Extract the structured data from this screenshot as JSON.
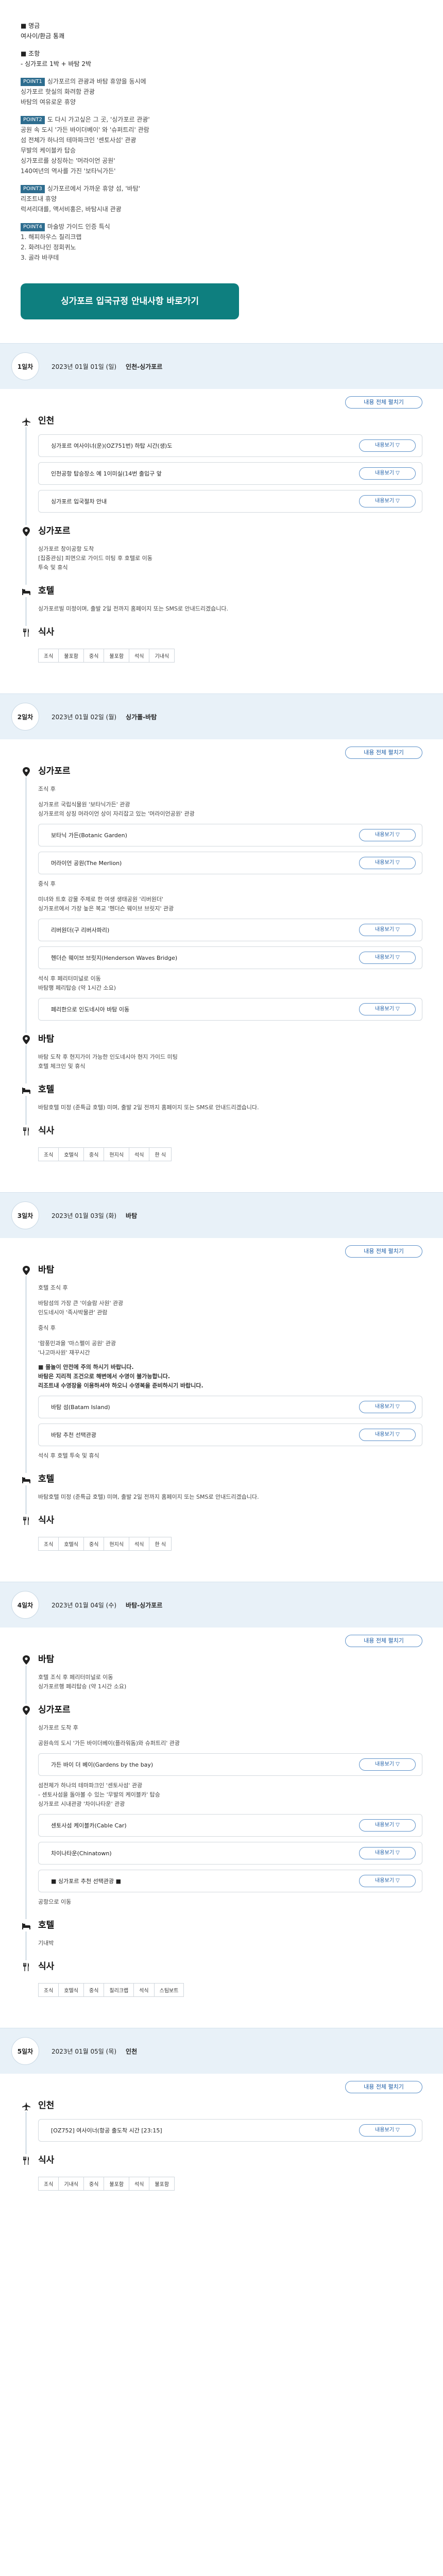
{
  "intro": {
    "heading_lines": [
      "■ 명금",
      "여사이/환금 통쾌"
    ],
    "block1": [
      "■ 조항",
      "- 싱가포르 1박 + 바탐 2박"
    ],
    "points": [
      {
        "badge": "POINT1",
        "lines": [
          "싱가포르의 관광과 바탐 휴양을 동시에",
          "싱가포르 핫실의 화려함 관광",
          "바탐의 여유로운 휴양"
        ]
      },
      {
        "badge": "POINT2",
        "lines": [
          "도 다시 가고싶은 그 곳, '싱가포르 관광'",
          "공원 속 도시 '가든 바이더베이' 와 '슈퍼트리' 관람",
          "섬 전체가 하나의 테마파크인 '센토사섬' 관광",
          "무발의 케이블카 탑승",
          "싱가포르를 상징하는 '머라이언 공원'",
          "140여년의 역사를 가진 '보타닉가든'"
        ]
      },
      {
        "badge": "POINT3",
        "lines": [
          "싱가포르에서 가까운 휴양 섬, '바탐'",
          "리조트내 휴양",
          "럭셔리대를, 액서비홍은, 바탐시내 관광"
        ]
      },
      {
        "badge": "POINT4",
        "lines": [
          "마술방 가이드 인증 특식",
          "1. 해피하우스 칠리크랩",
          "2. 화려나인 정회퀴노",
          "3. 골라 바쿠테"
        ]
      }
    ],
    "cta": "싱가포르 입국규정 안내사항 바로가기"
  },
  "ui": {
    "expand_all": "내용 전체 펼치기",
    "detail": "내용보기 ▽"
  },
  "meal_labels": [
    "조식",
    "중식",
    "석식"
  ],
  "days": [
    {
      "badge": "1일차",
      "date": "2023년 01월 01일 (일)",
      "route": "인천-싱가포르",
      "sections": [
        {
          "title": "인천",
          "lines": [],
          "items": [
            {
              "name": "싱가포르 여사이너(운)(OZ751번) 하탑 시간(생)도"
            },
            {
              "name": "인천공항 탑승장소 예 1이미실(14번 출입구 앞"
            },
            {
              "name": "싱가포르 입국절차 안내"
            }
          ]
        },
        {
          "title": "싱가포르",
          "lines": [
            "싱가포르 창이공항 도착",
            "[집중관심] 피면으로 가이드 미팅 후 호텔로 이동",
            "투숙 및 휴식"
          ],
          "items": []
        },
        {
          "title": "호텔",
          "lines": [
            "싱가포르빌 미정이며, 출발 2일 전까지 홈페이지 또는 SMS로 안내드리겠습니다."
          ],
          "items": []
        },
        {
          "title": "식사",
          "meals": [
            "불포함",
            "불포함",
            "기내식"
          ],
          "lines": [],
          "items": []
        }
      ]
    },
    {
      "badge": "2일차",
      "date": "2023년 01월 02일 (월)",
      "route": "싱가폴-바탐",
      "sections": [
        {
          "title": "싱가포르",
          "lines": [
            "조식 후",
            "",
            "싱가포르 국립식물원 '보타닉가든' 관광",
            "싱가포르의 상징 머라이언 상이 자리잡고 있는 '머라이언공원' 관광"
          ],
          "items": [
            {
              "name": "보타닉 가든(Botanic Garden)"
            },
            {
              "name": "머라이언 공원(The Merlion)"
            }
          ],
          "after": [
            "중식 후",
            "",
            "미녀와 트호 강물 주제로 한 여생 생태공원 '리버원더'",
            "싱가포르에서 가장 높은 복교 '헨더슨 웨이브 브릿지' 관광"
          ],
          "items2": [
            {
              "name": "리버원더(구 리버사파리)"
            },
            {
              "name": "헨더슨 웨이브 브릿지(Henderson Waves Bridge)"
            }
          ],
          "after2": [
            "석식 후 페리터미널로 이동",
            "바탐행 페리탑승 (약 1시간 소요)"
          ],
          "items3": [
            {
              "name": "페리한으로 인도네시아 바탐 이동"
            }
          ]
        },
        {
          "title": "바탐",
          "lines": [
            "바탐 도착 후 현지가이 가능한 인도네시아 현지 가이드 미팅",
            "호텔 체크인 및 휴식"
          ],
          "items": []
        },
        {
          "title": "호텔",
          "lines": [
            "바탐호텔 미정 (준특급 호텔) 미며, 출발 2일 전까지 홈페이지 또는 SMS로 안내드리겠습니다."
          ],
          "items": []
        },
        {
          "title": "식사",
          "meals": [
            "호텔식",
            "현지식",
            "한 식"
          ],
          "lines": [],
          "items": []
        }
      ]
    },
    {
      "badge": "3일차",
      "date": "2023년 01월 03일 (화)",
      "route": "바탐",
      "sections": [
        {
          "title": "바탐",
          "lines": [
            "호텔 조식 후",
            "",
            "바탐섬의 가장 큰 '이슬람 사원' 관광",
            "인도네시아 '족사박물관' 관람",
            "",
            "중식 후",
            "",
            "'람풍민과을 '마스펠이 공원' 관광",
            "'나고마사원' 재꾸시간"
          ],
          "note": [
            "■ 몰놀이 안전에 주의 하시기 바랍니다.",
            "바탐은 지리적 조건으로 해변에서 수영이 불가능합니다.",
            "리조트내 수영장을 이용하셔야 하오니 수영복을 준비하시기 바랍니다."
          ],
          "items": [
            {
              "name": "바탐 섬(Batam Island)"
            },
            {
              "name": "바탐 추천 선택관광"
            }
          ],
          "after": [
            "석식 후 호텔 투숙 및 휴식"
          ]
        },
        {
          "title": "호텔",
          "lines": [
            "바탐호텔 미정 (준특급 호텔) 미며, 출발 2일 전까지 홈페이지 또는 SMS로 안내드리겠습니다."
          ],
          "items": []
        },
        {
          "title": "식사",
          "meals": [
            "호텔식",
            "현지식",
            "한 식"
          ],
          "lines": [],
          "items": []
        }
      ]
    },
    {
      "badge": "4일차",
      "date": "2023년 01월 04일 (수)",
      "route": "바탐-싱가포르",
      "sections": [
        {
          "title": "바탐",
          "lines": [
            "호텔 조식 후 페리터미널로 이동",
            "싱가포르행 페리탑승 (약 1시간 소요)"
          ],
          "items": []
        },
        {
          "title": "싱가포르",
          "lines": [
            "싱가포르 도착 후",
            "",
            "공원속의 도시 '가든 바이더베이(플라워돔)와 슈퍼트리' 관광"
          ],
          "items": [
            {
              "name": "가든 바이 더 베이(Gardens by the bay)"
            }
          ],
          "after": [
            "섬전체가 하나의 테마파크인 '센토사섬' 관광",
            "- 센토사섬을 돌아볼 수 있는 '무발의 케이블카' 탑승",
            "싱가포르 시내관광 '차이나타운' 관광"
          ],
          "items2": [
            {
              "name": "센토사섬 케이블카(Cable Car)"
            },
            {
              "name": "차이나타운(Chinatown)"
            },
            {
              "name": "■ 싱가포르 추천 선택관광 ■"
            }
          ],
          "after2": [
            "공항으로 이동"
          ]
        },
        {
          "title": "호텔",
          "lines": [
            "기내박"
          ],
          "items": []
        },
        {
          "title": "식사",
          "meals": [
            "호텔식",
            "칠리크랩",
            "스팀보트"
          ],
          "lines": [],
          "items": []
        }
      ]
    },
    {
      "badge": "5일차",
      "date": "2023년 01월 05일 (목)",
      "route": "인천",
      "sections": [
        {
          "title": "인천",
          "lines": [],
          "items": [
            {
              "name": "[OZ752] 여사이너(항공 출도착 시간 [23:15]"
            }
          ]
        },
        {
          "title": "식사",
          "meals": [
            "기내식",
            "불포함",
            "불포함"
          ],
          "lines": [],
          "items": []
        }
      ]
    }
  ]
}
